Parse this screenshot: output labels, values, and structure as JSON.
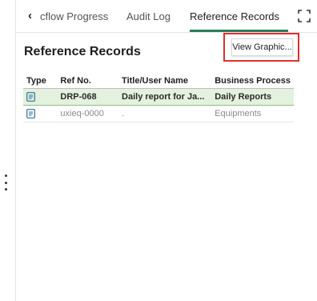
{
  "tabs": [
    {
      "label": "cflow Progress"
    },
    {
      "label": "Audit Log"
    },
    {
      "label": "Reference Records"
    }
  ],
  "active_tab": "Reference Records",
  "section": {
    "title": "Reference Records"
  },
  "toolbar": {
    "view_graphic_label": "View Graphic..."
  },
  "table": {
    "columns": [
      "Type",
      "Ref No.",
      "Title/User Name",
      "Business Process"
    ],
    "rows": [
      {
        "type_icon": "document-icon",
        "ref_no": "DRP-068",
        "title": "Daily report for Ja...",
        "process": "Daily Reports",
        "selected": true
      },
      {
        "type_icon": "document-icon",
        "ref_no": "uxieq-0000",
        "title": ".",
        "process": "Equipments",
        "selected": false
      }
    ]
  },
  "colors": {
    "accent": "#2e7d5b",
    "selected_row": "#e3f1de",
    "highlight_box": "#e0302d",
    "icon": "#2f6f9f"
  }
}
